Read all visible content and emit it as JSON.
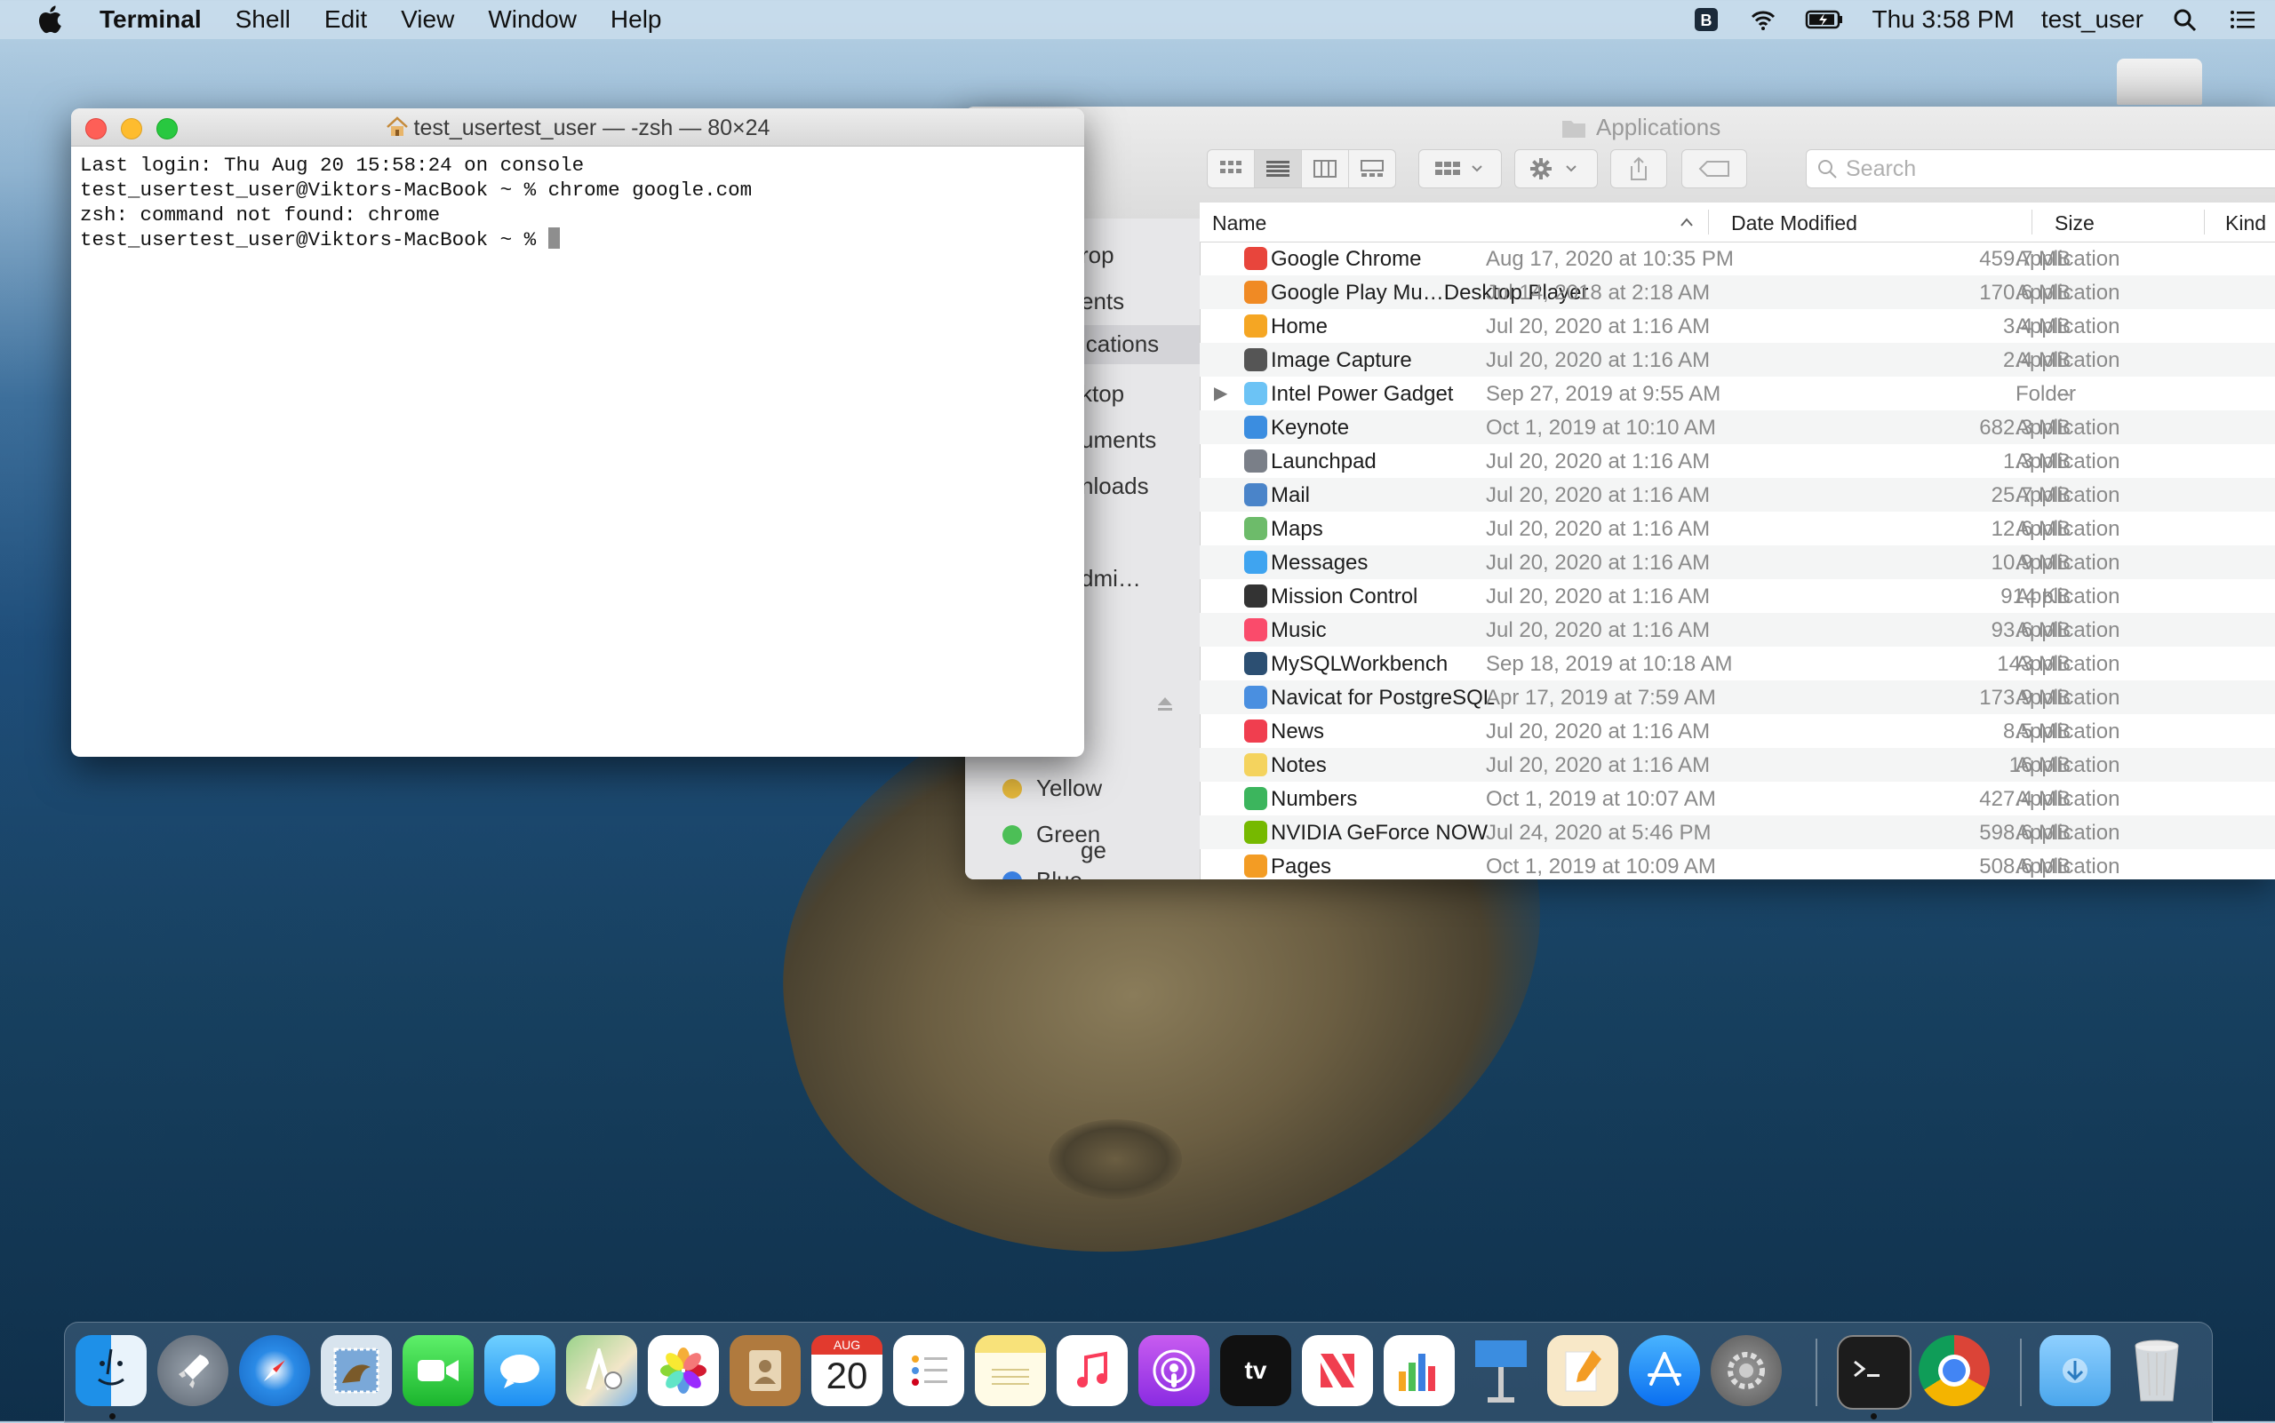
{
  "menubar": {
    "app_name": "Terminal",
    "menus": [
      "Shell",
      "Edit",
      "View",
      "Window",
      "Help"
    ],
    "clock": "Thu 3:58 PM",
    "user": "test_user"
  },
  "terminal": {
    "title": "test_usertest_user — -zsh — 80×24",
    "lines": [
      "Last login: Thu Aug 20 15:58:24 on console",
      "test_usertest_user@Viktors-MacBook ~ % chrome google.com",
      "zsh: command not found: chrome",
      "test_usertest_user@Viktors-MacBook ~ % "
    ]
  },
  "finder": {
    "title": "Applications",
    "search_placeholder": "Search",
    "sidebar": {
      "items": [
        "rop",
        "ents",
        "ications",
        "ktop",
        "uments",
        "nloads",
        "dmi…",
        "ge"
      ],
      "tags": [
        {
          "label": "Yellow",
          "color": "#e6b93c"
        },
        {
          "label": "Green",
          "color": "#4cbf56"
        },
        {
          "label": "Blue",
          "color": "#3a7fe0"
        }
      ]
    },
    "columns": {
      "name": "Name",
      "date": "Date Modified",
      "size": "Size",
      "kind": "Kind"
    },
    "rows": [
      {
        "name": "Google Chrome",
        "date": "Aug 17, 2020 at 10:35 PM",
        "size": "459.7 MB",
        "kind": "Application",
        "color": "#e8453c"
      },
      {
        "name": "Google Play Mu…Desktop Player",
        "date": "Jul 14, 2018 at 2:18 AM",
        "size": "170.6 MB",
        "kind": "Application",
        "color": "#f08a24"
      },
      {
        "name": "Home",
        "date": "Jul 20, 2020 at 1:16 AM",
        "size": "3.4 MB",
        "kind": "Application",
        "color": "#f5a623"
      },
      {
        "name": "Image Capture",
        "date": "Jul 20, 2020 at 1:16 AM",
        "size": "2.4 MB",
        "kind": "Application",
        "color": "#555555"
      },
      {
        "name": "Intel Power Gadget",
        "date": "Sep 27, 2019 at 9:55 AM",
        "size": "--",
        "kind": "Folder",
        "color": "#6cc3f5"
      },
      {
        "name": "Keynote",
        "date": "Oct 1, 2019 at 10:10 AM",
        "size": "682.3 MB",
        "kind": "Application",
        "color": "#3b8de0"
      },
      {
        "name": "Launchpad",
        "date": "Jul 20, 2020 at 1:16 AM",
        "size": "1.3 MB",
        "kind": "Application",
        "color": "#7a7f88"
      },
      {
        "name": "Mail",
        "date": "Jul 20, 2020 at 1:16 AM",
        "size": "25.7 MB",
        "kind": "Application",
        "color": "#4a84c9"
      },
      {
        "name": "Maps",
        "date": "Jul 20, 2020 at 1:16 AM",
        "size": "12.6 MB",
        "kind": "Application",
        "color": "#6dbb6a"
      },
      {
        "name": "Messages",
        "date": "Jul 20, 2020 at 1:16 AM",
        "size": "10.9 MB",
        "kind": "Application",
        "color": "#3fa4f0"
      },
      {
        "name": "Mission Control",
        "date": "Jul 20, 2020 at 1:16 AM",
        "size": "914 KB",
        "kind": "Application",
        "color": "#333333"
      },
      {
        "name": "Music",
        "date": "Jul 20, 2020 at 1:16 AM",
        "size": "93.6 MB",
        "kind": "Application",
        "color": "#fa4b6b"
      },
      {
        "name": "MySQLWorkbench",
        "date": "Sep 18, 2019 at 10:18 AM",
        "size": "143 MB",
        "kind": "Application",
        "color": "#2c4f72"
      },
      {
        "name": "Navicat for PostgreSQL",
        "date": "Apr 17, 2019 at 7:59 AM",
        "size": "173.9 MB",
        "kind": "Application",
        "color": "#4a8fe0"
      },
      {
        "name": "News",
        "date": "Jul 20, 2020 at 1:16 AM",
        "size": "8.5 MB",
        "kind": "Application",
        "color": "#f03e4f"
      },
      {
        "name": "Notes",
        "date": "Jul 20, 2020 at 1:16 AM",
        "size": "16 MB",
        "kind": "Application",
        "color": "#f4d35e"
      },
      {
        "name": "Numbers",
        "date": "Oct 1, 2019 at 10:07 AM",
        "size": "427.4 MB",
        "kind": "Application",
        "color": "#3cb55d"
      },
      {
        "name": "NVIDIA GeForce NOW",
        "date": "Jul 24, 2020 at 5:46 PM",
        "size": "598.6 MB",
        "kind": "Application",
        "color": "#76b900"
      },
      {
        "name": "Pages",
        "date": "Oct 1, 2019 at 10:09 AM",
        "size": "508.6 MB",
        "kind": "Application",
        "color": "#f39c24"
      }
    ]
  },
  "dock": {
    "calendar_month": "AUG",
    "calendar_day": "20",
    "appletv_label": "tv"
  }
}
